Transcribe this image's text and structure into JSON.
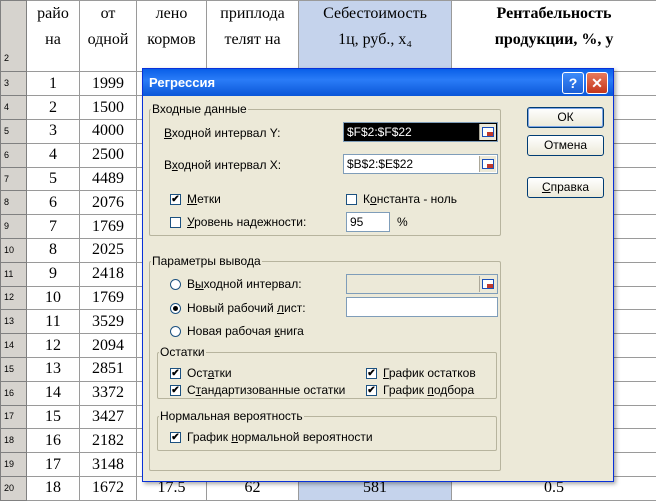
{
  "spreadsheet": {
    "header_rows": [
      [
        "2",
        "райо\nна",
        "от\nодной",
        "лено\nкормов",
        "приплода\nтелят на",
        "Себестоимость\n1ц, руб., x₄",
        "Рентабельность\nпродукции, %, y"
      ]
    ],
    "rows": [
      [
        "3",
        "1",
        "1999"
      ],
      [
        "4",
        "2",
        "1500"
      ],
      [
        "5",
        "3",
        "4000"
      ],
      [
        "6",
        "4",
        "2500"
      ],
      [
        "7",
        "5",
        "4489"
      ],
      [
        "8",
        "6",
        "2076"
      ],
      [
        "9",
        "7",
        "1769"
      ],
      [
        "10",
        "8",
        "2025"
      ],
      [
        "11",
        "9",
        "2418"
      ],
      [
        "12",
        "10",
        "1769"
      ],
      [
        "13",
        "11",
        "3529"
      ],
      [
        "14",
        "12",
        "2094"
      ],
      [
        "15",
        "13",
        "2851"
      ],
      [
        "16",
        "14",
        "3372"
      ],
      [
        "17",
        "15",
        "3427"
      ],
      [
        "18",
        "16",
        "2182"
      ],
      [
        "19",
        "17",
        "3148"
      ]
    ],
    "last_row": [
      "20",
      "18",
      "1672",
      "17.5",
      "62",
      "581",
      "0.5"
    ],
    "colors": {
      "row_header_bg": "#d6d3ce",
      "selection": "#c5d3ec",
      "grid": "#9a9a9a"
    }
  },
  "dialog": {
    "title": "Регрессия",
    "help_glyph": "?",
    "close_glyph": "✕",
    "input_group": {
      "legend": "Входные данные",
      "y_label_accel": "В",
      "y_label_rest": "ходной интервал Y:",
      "y_value": "$F$2:$F$22",
      "x_label_pre": "В",
      "x_label_accel": "х",
      "x_label_rest": "одной интервал X:",
      "x_value": "$B$2:$E$22",
      "labels_accel": "М",
      "labels_rest": "етки",
      "labels_checked": "✔",
      "const_pre": "К",
      "const_accel": "о",
      "const_rest": "нстанта - ноль",
      "conf_accel": "У",
      "conf_rest": "ровень надежности:",
      "conf_value": "95",
      "conf_unit": "%"
    },
    "output_group": {
      "legend": "Параметры вывода",
      "out_range_pre": "В",
      "out_range_accel": "ы",
      "out_range_rest": "ходной интервал:",
      "new_sheet_pre": "Новый рабочий ",
      "new_sheet_accel": "л",
      "new_sheet_rest": "ист:",
      "new_book_pre": "Новая рабочая ",
      "new_book_accel": "к",
      "new_book_rest": "нига"
    },
    "residuals_group": {
      "legend": "Остатки",
      "resid_pre": "Ост",
      "resid_accel": "а",
      "resid_rest": "тки",
      "resid_checked": "✔",
      "resid_plot_accel": "Г",
      "resid_plot_rest": "рафик остатков",
      "resid_plot_checked": "✔",
      "std_pre": "С",
      "std_accel": "т",
      "std_rest": "андартизованные остатки",
      "std_checked": "✔",
      "fit_pre": "График ",
      "fit_accel": "п",
      "fit_rest": "одбора",
      "fit_checked": "✔"
    },
    "normal_group": {
      "legend": "Нормальная вероятность",
      "np_pre": "График ",
      "np_accel": "н",
      "np_rest": "ормальной вероятности",
      "np_checked": "✔"
    },
    "buttons": {
      "ok": "ОК",
      "cancel": "Отмена",
      "help_accel": "С",
      "help_rest": "правка"
    }
  }
}
